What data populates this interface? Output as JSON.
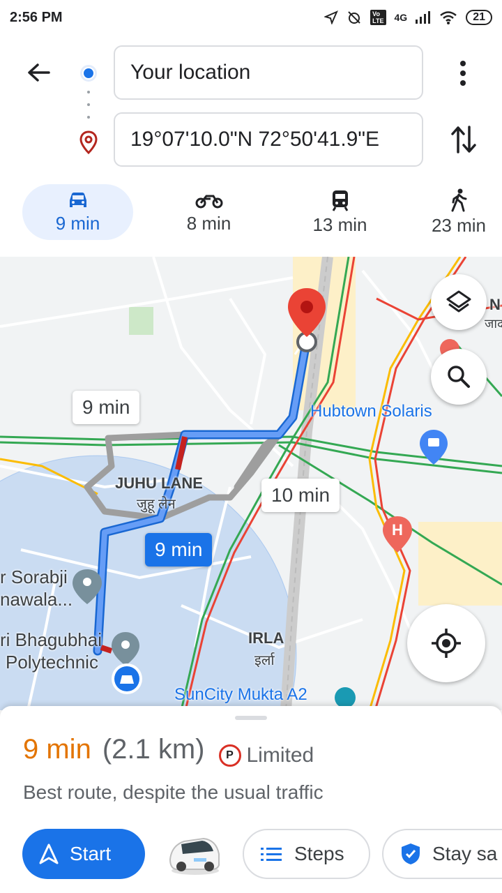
{
  "status_bar": {
    "time": "2:56 PM",
    "network": "4G",
    "battery": "21"
  },
  "directions": {
    "origin": "Your location",
    "destination": "19°07'10.0\"N 72°50'41.9\"E"
  },
  "modes": [
    {
      "label": "9 min",
      "icon": "car-icon",
      "active": true
    },
    {
      "label": "8 min",
      "icon": "motorcycle-icon",
      "active": false
    },
    {
      "label": "13 min",
      "icon": "train-icon",
      "active": false
    },
    {
      "label": "23 min",
      "icon": "walk-icon",
      "active": false
    }
  ],
  "map": {
    "route_labels": {
      "alt1": "9 min",
      "primary": "9 min",
      "alt2": "10 min"
    },
    "places": {
      "hubtown": "Hubtown Solaris",
      "juhu_lane": "JUHU LANE",
      "juhu_lane_hi": "जुहू लेन",
      "sorabji": "r Sorabji",
      "nawala": "nawala...",
      "bhagubhai": "ri Bhagubhai",
      "polytechnic": "Polytechnic",
      "irla": "IRLA",
      "irla_hi": "इर्ला",
      "suncity": "SunCity Mukta A2",
      "n_label": "N",
      "n_hi": "जाद"
    }
  },
  "route": {
    "time": "9 min",
    "distance": "(2.1 km)",
    "parking": "Limited",
    "parking_icon_letter": "P",
    "description": "Best route, despite the usual traffic"
  },
  "actions": {
    "start": "Start",
    "steps": "Steps",
    "stay_safe": "Stay sa"
  },
  "colors": {
    "accent": "#1a73e8",
    "time": "#e37400",
    "pin": "#d93025"
  }
}
